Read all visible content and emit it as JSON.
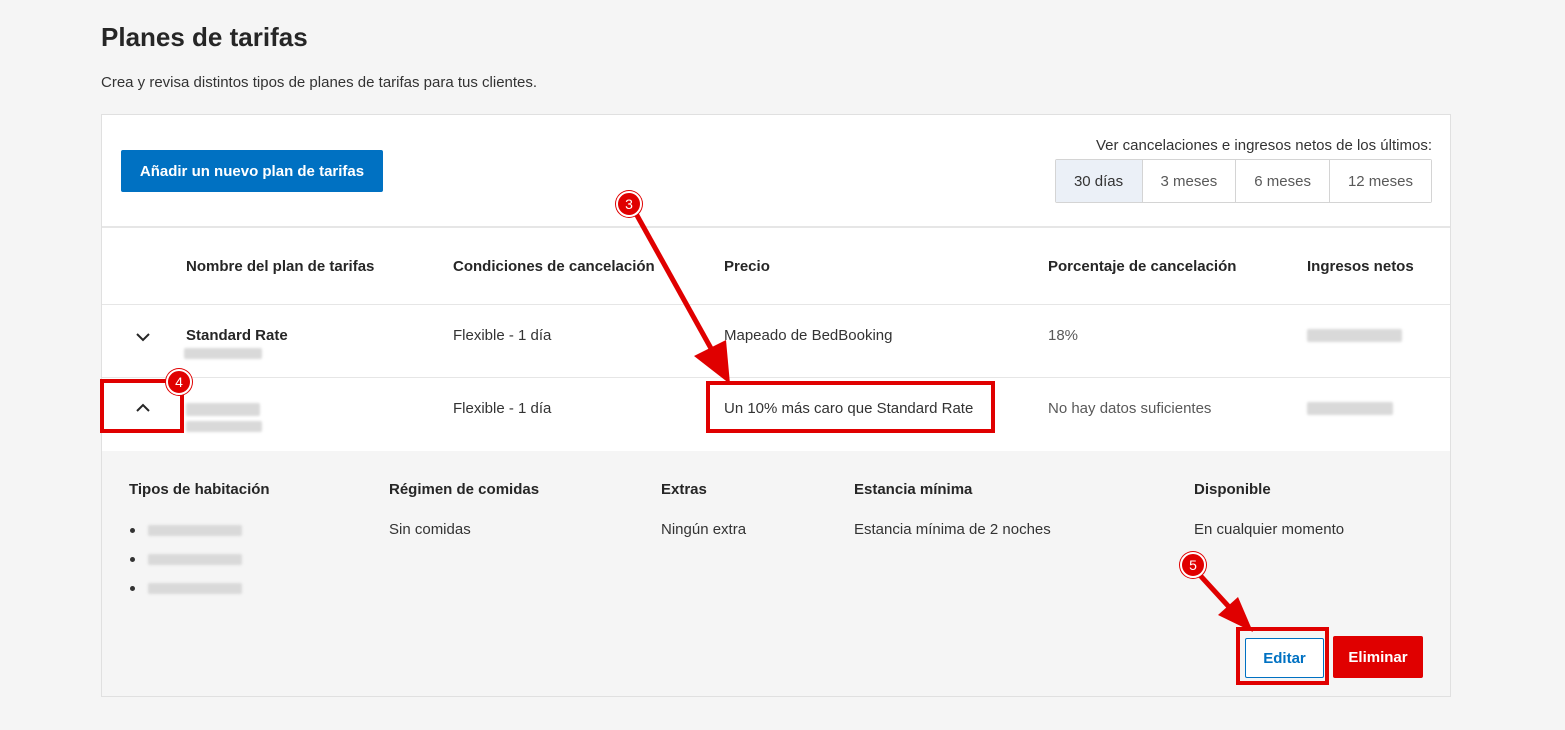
{
  "page": {
    "title": "Planes de tarifas",
    "subtitle": "Crea y revisa distintos tipos de planes de tarifas para tus clientes."
  },
  "toolbar": {
    "add_label": "Añadir un nuevo plan de tarifas",
    "period_label": "Ver cancelaciones e ingresos netos de los últimos:",
    "periods": [
      "30 días",
      "3 meses",
      "6 meses",
      "12 meses"
    ],
    "active_period": "30 días"
  },
  "table": {
    "headers": [
      "Nombre del plan de tarifas",
      "Condiciones de cancelación",
      "Precio",
      "Porcentaje de cancelación",
      "Ingresos netos"
    ],
    "rows": [
      {
        "name": "Standard Rate",
        "cancellation": "Flexible - 1 día",
        "price": "Mapeado de BedBooking",
        "cancel_pct": "18%",
        "expanded": false
      },
      {
        "name": "",
        "cancellation": "Flexible - 1 día",
        "price": "Un 10% más caro que Standard Rate",
        "cancel_pct": "No hay datos suficientes",
        "expanded": true
      }
    ]
  },
  "detail": {
    "headers": [
      "Tipos de habitación",
      "Régimen de comidas",
      "Extras",
      "Estancia mínima",
      "Disponible"
    ],
    "meal_plan": "Sin comidas",
    "extras": "Ningún extra",
    "min_stay": "Estancia mínima de 2 noches",
    "availability": "En cualquier momento",
    "edit_label": "Editar",
    "delete_label": "Eliminar"
  },
  "annotations": {
    "markers": [
      "3",
      "4",
      "5"
    ],
    "color": "#e00000"
  },
  "colors": {
    "primary": "#0071c2",
    "danger": "#e00000"
  }
}
